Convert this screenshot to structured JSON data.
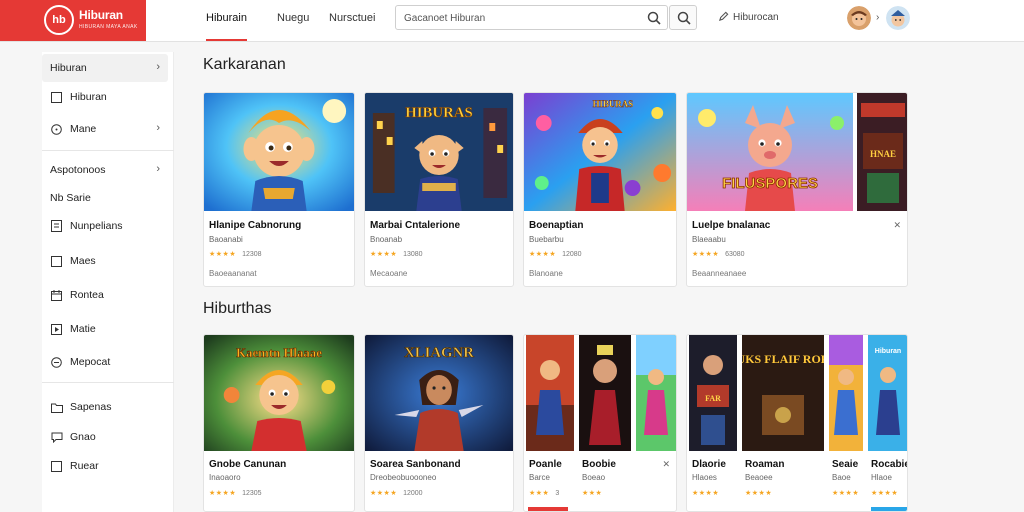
{
  "header": {
    "logo_badge": "hb",
    "logo_name": "Hiburan",
    "logo_tagline": "HIBURAN MAYA ANAK",
    "nav": [
      "Hiburain",
      "Nuegu",
      "Nursctuei"
    ],
    "search_placeholder": "Gacanoet Hiburan",
    "upload_label": "Hiburocan"
  },
  "sidebar": {
    "group1": [
      {
        "label": "Hiburan",
        "icon": "none",
        "chevron": "›"
      },
      {
        "label": "Hiburan",
        "icon": "square-icon"
      },
      {
        "label": "Mane",
        "icon": "circle-icon",
        "chevron": "›"
      }
    ],
    "group2": [
      {
        "label": "Aspotonoos",
        "icon": "none",
        "chevron": "›"
      },
      {
        "label": "Nb Sarie",
        "icon": "none"
      },
      {
        "label": "Nunpelians",
        "icon": "doc-icon"
      },
      {
        "label": "Maes",
        "icon": "square-icon"
      },
      {
        "label": "Rontea",
        "icon": "calendar-icon"
      },
      {
        "label": "Matie",
        "icon": "square-icon"
      },
      {
        "label": "Mepocat",
        "icon": "circle-icon"
      }
    ],
    "group3": [
      {
        "label": "Sapenas",
        "icon": "folder-icon"
      },
      {
        "label": "Gnao",
        "icon": "chat-icon"
      },
      {
        "label": "Ruear",
        "icon": "square-icon"
      }
    ]
  },
  "section1": {
    "title": "Karkaranan",
    "cards": [
      {
        "title": "Hlanipe Cabnorung",
        "sub": "Baoanabi",
        "stars": "★★★★",
        "count": "12308",
        "meta": "Baoeaananat"
      },
      {
        "title": "Marbai Cntalerione",
        "sub": "Bnoanab",
        "stars": "★★★★",
        "count": "13080",
        "meta": "Mecaoane"
      },
      {
        "title": "Boenaptian",
        "sub": "Buebarbu",
        "stars": "★★★★",
        "count": "12080",
        "meta": "Blanoane"
      },
      {
        "title": "Luelpe bnalanac",
        "sub": "Blaeaabu",
        "stars": "★★★★",
        "count": "63080",
        "meta": "Beaanneanaee"
      },
      {
        "title": "",
        "sub": "",
        "stars": "",
        "count": "",
        "meta": ""
      }
    ]
  },
  "section2": {
    "title": "Hiburthas",
    "cards": [
      {
        "title": "Gnobe Canunan",
        "sub": "Inaoaoro",
        "stars": "★★★★",
        "count": "12305"
      },
      {
        "title": "Soarea Sanbonand",
        "sub": "Dreobeobuoooneo",
        "stars": "★★★★",
        "count": "12000"
      },
      {
        "title": "Poanle",
        "sub": "Barce",
        "stars": "★★★",
        "count": "3"
      },
      {
        "title": "Boobie",
        "sub": "Boeao",
        "stars": "★★★",
        "count": ""
      },
      {
        "title": "Dlaorie",
        "sub": "Hlaoes",
        "stars": "★★★★",
        "count": ""
      },
      {
        "title": "Roaman",
        "sub": "Beaoee",
        "stars": "★★★★",
        "count": ""
      },
      {
        "title": "Seaie",
        "sub": "Baoe",
        "stars": "★★★★",
        "count": ""
      },
      {
        "title": "Rocabie",
        "sub": "Hlaoe",
        "stars": "★★★★",
        "count": ""
      }
    ]
  },
  "poster_text": {
    "p1": "HIBURAS",
    "p2": "FILUSPORES",
    "p3": "Kaemtn Hlaaae",
    "p4": "XLIAGNR",
    "p5": "BRUKS FLAIF RORAE",
    "p6": "Hiburan"
  }
}
